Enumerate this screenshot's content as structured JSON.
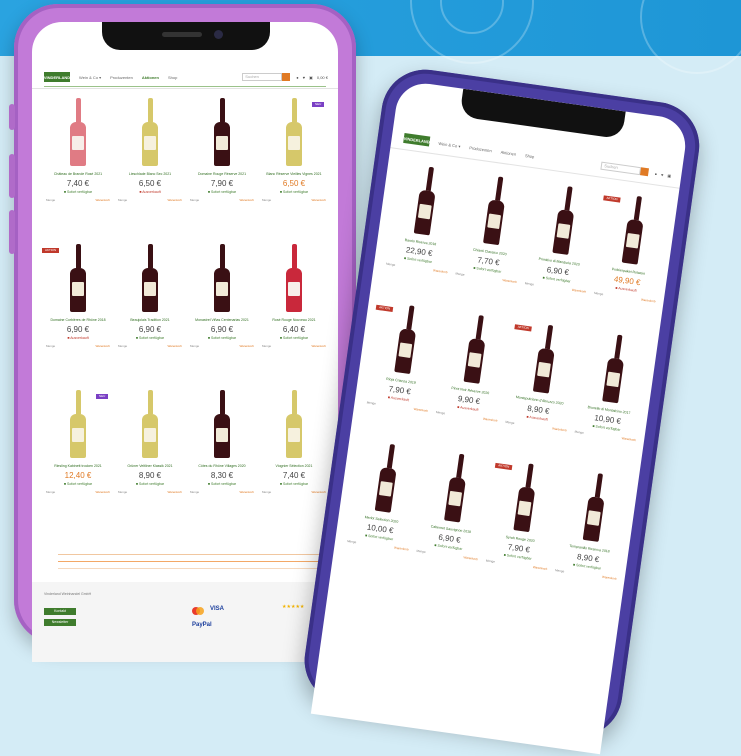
{
  "nav": {
    "logo": "VINDERLAND",
    "links": [
      "Wein & Co ▾",
      "Produzenten",
      "Aktionen",
      "Shop"
    ],
    "search_placeholder": "Suchen",
    "cart": "0,00 €"
  },
  "colors": {
    "accent_green": "#3f7c2d",
    "price_orange": "#e07a24",
    "left_phone": "#c27ad8",
    "right_phone": "#4b3fa3",
    "band_blue": "#2aa3e0"
  },
  "left_products": [
    {
      "name": "Château de Brande Rosé 2021",
      "price": "7,40 €",
      "stock": "Sofort verfügbar",
      "stock_ok": true,
      "wine": "rose",
      "badge": ""
    },
    {
      "name": "Lieschlade Blanc Sec 2021",
      "price": "6,50 €",
      "stock": "Ausverkauft",
      "stock_ok": false,
      "wine": "white",
      "badge": ""
    },
    {
      "name": "Domaine Rouge Réserve 2021",
      "price": "7,90 €",
      "stock": "Sofort verfügbar",
      "stock_ok": true,
      "wine": "red",
      "badge": ""
    },
    {
      "name": "Blanc Réserve Vieilles Vignes 2021",
      "price": "6,50 €",
      "stock": "Sofort verfügbar",
      "stock_ok": true,
      "wine": "white",
      "badge": "NEU",
      "sale": true
    },
    {
      "name": "Domaine Corbières de Rhône 2018",
      "price": "6,90 €",
      "stock": "Ausverkauft",
      "stock_ok": false,
      "wine": "red",
      "badge": "AKTION"
    },
    {
      "name": "Beaujolais Tradition 2021",
      "price": "6,90 €",
      "stock": "Sofort verfügbar",
      "stock_ok": true,
      "wine": "red",
      "badge": ""
    },
    {
      "name": "Monastrel Viñas Centenarias 2021",
      "price": "6,90 €",
      "stock": "Sofort verfügbar",
      "stock_ok": true,
      "wine": "red",
      "badge": ""
    },
    {
      "name": "Rosé Rouge Nouveau 2021",
      "price": "6,40 €",
      "stock": "Sofort verfügbar",
      "stock_ok": true,
      "wine": "rosered",
      "badge": ""
    },
    {
      "name": "Riesling Kabinett trocken 2021",
      "price": "12,40 €",
      "stock": "Sofort verfügbar",
      "stock_ok": true,
      "wine": "white",
      "badge": "NEU",
      "sale": true
    },
    {
      "name": "Grüner Veltliner Klassik 2021",
      "price": "8,90 €",
      "stock": "Sofort verfügbar",
      "stock_ok": true,
      "wine": "white",
      "badge": ""
    },
    {
      "name": "Côtes du Rhône Villages 2020",
      "price": "8,30 €",
      "stock": "Sofort verfügbar",
      "stock_ok": true,
      "wine": "red",
      "badge": ""
    },
    {
      "name": "Viognier Sélection 2021",
      "price": "7,40 €",
      "stock": "Sofort verfügbar",
      "stock_ok": true,
      "wine": "white",
      "badge": ""
    }
  ],
  "right_products": [
    {
      "name": "Barolo Riserva 2018",
      "price": "22,90 €",
      "stock": "Sofort verfügbar",
      "stock_ok": true,
      "wine": "red",
      "badge": ""
    },
    {
      "name": "Chianti Classico 2020",
      "price": "7,70 €",
      "stock": "Sofort verfügbar",
      "stock_ok": true,
      "wine": "red",
      "badge": ""
    },
    {
      "name": "Primitivo di Manduria 2020",
      "price": "6,90 €",
      "stock": "Sofort verfügbar",
      "stock_ok": true,
      "wine": "red",
      "badge": ""
    },
    {
      "name": "Probierpaket Rotwein",
      "price": "49,90 €",
      "stock": "Ausverkauft",
      "stock_ok": false,
      "wine": "red",
      "badge": "AKTION",
      "sale": true
    },
    {
      "name": "Rioja Crianza 2019",
      "price": "7,90 €",
      "stock": "Ausverkauft",
      "stock_ok": false,
      "wine": "red",
      "badge": "AKTION"
    },
    {
      "name": "Pinot Noir Réserve 2020",
      "price": "9,90 €",
      "stock": "Ausverkauft",
      "stock_ok": false,
      "wine": "red",
      "badge": ""
    },
    {
      "name": "Montepulciano d'Abruzzo 2020",
      "price": "8,90 €",
      "stock": "Ausverkauft",
      "stock_ok": false,
      "wine": "red",
      "badge": "AKTION"
    },
    {
      "name": "Brunello di Montalcino 2017",
      "price": "10,90 €",
      "stock": "Sofort verfügbar",
      "stock_ok": true,
      "wine": "red",
      "badge": ""
    },
    {
      "name": "Merlot Selection 2020",
      "price": "10,00 €",
      "stock": "Sofort verfügbar",
      "stock_ok": true,
      "wine": "red",
      "badge": ""
    },
    {
      "name": "Cabernet Sauvignon 2019",
      "price": "6,90 €",
      "stock": "Sofort verfügbar",
      "stock_ok": true,
      "wine": "red",
      "badge": ""
    },
    {
      "name": "Syrah Rouge 2020",
      "price": "7,90 €",
      "stock": "Sofort verfügbar",
      "stock_ok": true,
      "wine": "red",
      "badge": "AKTION"
    },
    {
      "name": "Tempranillo Reserva 2018",
      "price": "8,90 €",
      "stock": "Sofort verfügbar",
      "stock_ok": true,
      "wine": "red",
      "badge": ""
    }
  ],
  "product_rows": {
    "label_a": "Menge",
    "label_b": "Warenkorb"
  },
  "footer": {
    "company": "Vinderland Weinhandel GmbH",
    "btn1": "Kontakt",
    "btn2": "Newsletter",
    "payments": [
      "VISA",
      "PayPal"
    ],
    "rating": "★★★★★"
  }
}
